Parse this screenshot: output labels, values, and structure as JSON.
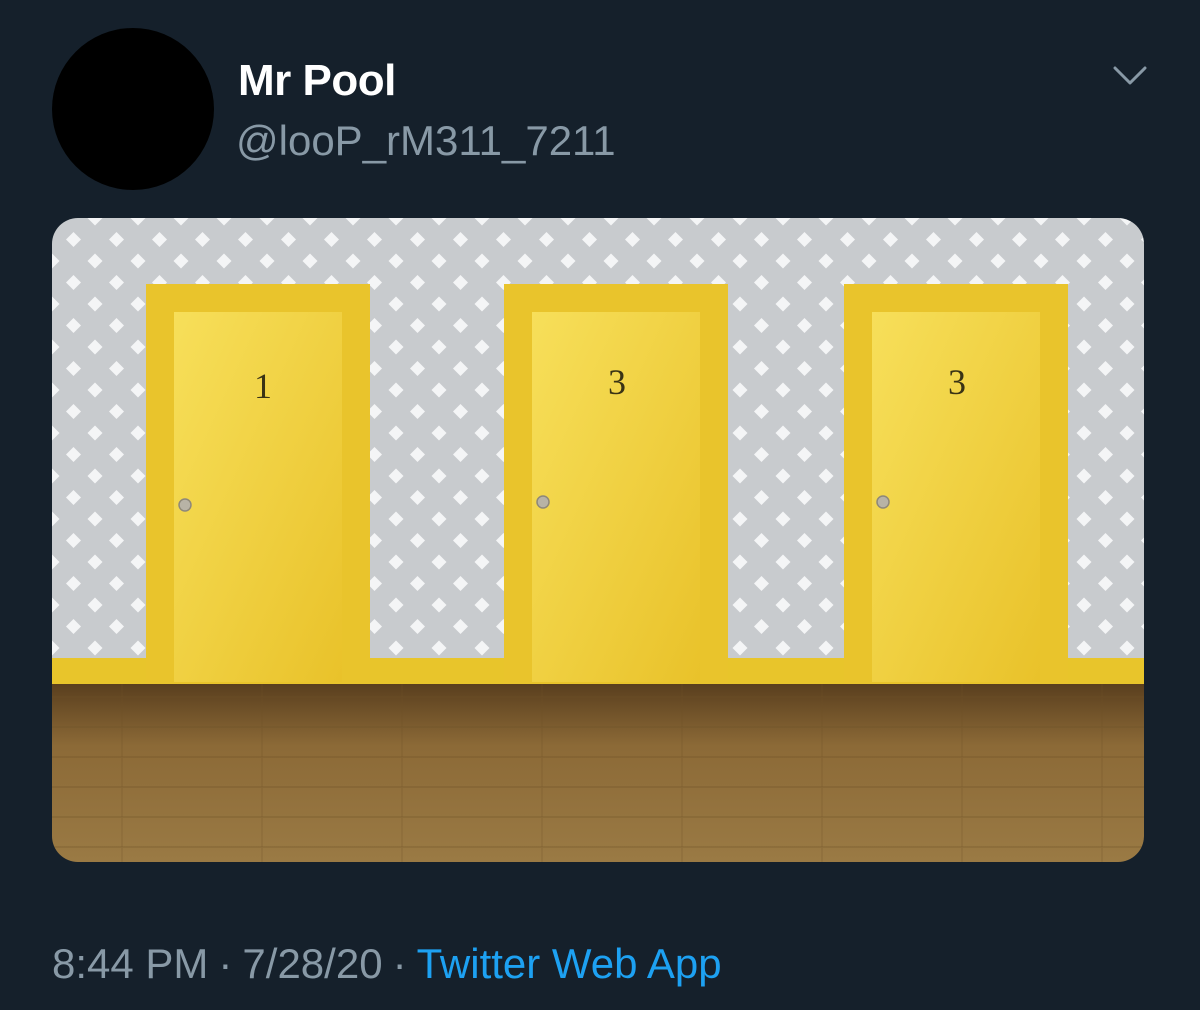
{
  "tweet": {
    "author": {
      "display_name": "Mr Pool",
      "handle": "@looP_rM311_7211"
    },
    "menu_icon": "chevron-down-icon",
    "image": {
      "door_numbers": [
        "1",
        "3",
        "3"
      ]
    },
    "footer": {
      "time": "8:44 PM",
      "separator": "·",
      "date": "7/28/20",
      "source": "Twitter Web App"
    }
  },
  "colors": {
    "background": "#15202b",
    "name": "#ffffff",
    "secondary_text": "#8899a6",
    "link": "#1da1f2",
    "door_yellow": "#f3d238",
    "wall": "#c9cccf",
    "floor": "#8a6633"
  }
}
